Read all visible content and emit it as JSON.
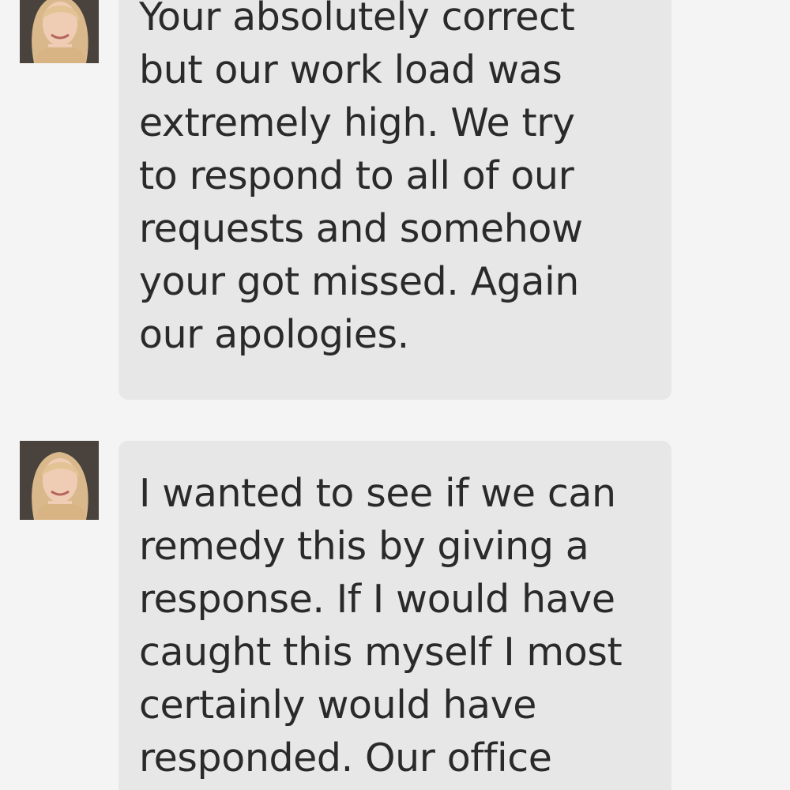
{
  "colors": {
    "background": "#f4f4f4",
    "bubble": "#e7e7e7",
    "text": "#2a2a2a"
  },
  "messages": [
    {
      "sender_avatar": "avatar-photo",
      "lines": [
        "Your absolutely correct",
        "but our work load was",
        "extremely high. We try",
        "to respond to all of our",
        "requests and somehow",
        "your got missed. Again",
        "our apologies."
      ]
    },
    {
      "sender_avatar": "avatar-photo",
      "lines": [
        "I wanted to see if we can",
        "remedy this by giving a",
        "response. If I would have",
        "caught this myself I most",
        "certainly would have",
        "responded. Our office"
      ]
    }
  ]
}
